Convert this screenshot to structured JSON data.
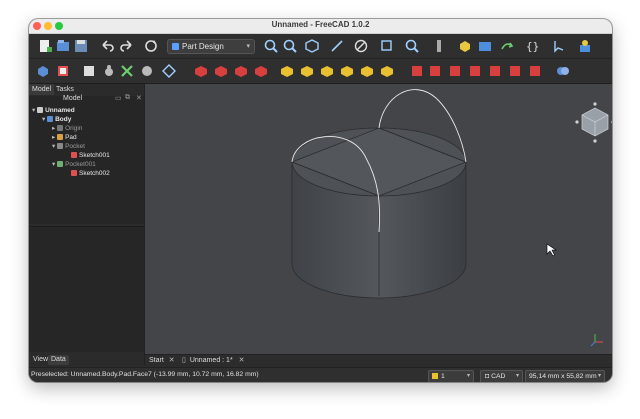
{
  "window": {
    "title": "Unnamed - FreeCAD 1.0.2"
  },
  "workbench": {
    "selected": "Part Design"
  },
  "combo_view": {
    "tabs": [
      "Model",
      "Tasks"
    ],
    "tree_header": "Model",
    "tree": [
      {
        "label": "Unnamed",
        "level": 0
      },
      {
        "label": "Body",
        "level": 1
      },
      {
        "label": "Origin",
        "level": 2
      },
      {
        "label": "Pad",
        "level": 2
      },
      {
        "label": "Pocket",
        "level": 2
      },
      {
        "label": "Sketch001",
        "level": 3
      },
      {
        "label": "Pocket001",
        "level": 2
      },
      {
        "label": "Sketch002",
        "level": 3
      }
    ],
    "bottom_tabs": [
      "View",
      "Data"
    ]
  },
  "doc_tabs": [
    "Start",
    "Unnamed : 1*"
  ],
  "statusbar": {
    "message": "Preselected: Unnamed.Body.Pad.Face7 (-13.99 mm, 10.72 mm, 16.82 mm)",
    "layer": "1",
    "nav_style": "CAD",
    "dimensions": "95,14 mm x 55,82 mm"
  },
  "colors": {
    "viewport_bg": "#444548",
    "titlebar": "#ececec",
    "toolbar": "#2f2f2f"
  }
}
